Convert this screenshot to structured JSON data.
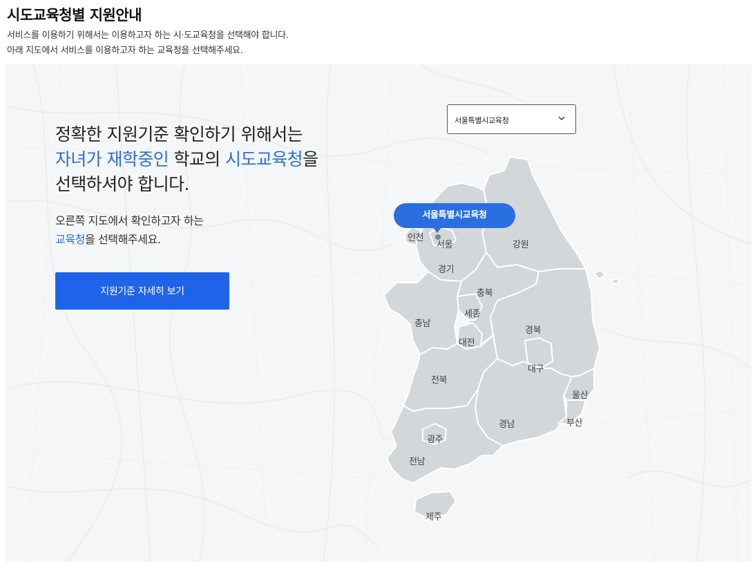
{
  "page": {
    "title": "시도교육청별 지원안내",
    "description_line1": "서비스를 이용하기 위해서는 이용하고자 하는 시·도교육청을 선택해야 합니다.",
    "description_line2": "아래 지도에서 서비스를 이용하고자 하는 교육청을 선택해주세요."
  },
  "hero": {
    "line1": "정확한 지원기준 확인하기 위해서는",
    "line2_highlight_a": "자녀가 재학중인",
    "line2_mid": " 학교의 ",
    "line2_highlight_b": "시도교육청",
    "line2_end": "을",
    "line3": "선택하셔야 합니다.",
    "sub_line1": "오른쪽 지도에서 확인하고자 하는",
    "sub_highlight": "교육청",
    "sub_line2_rest": "을 선택해주세요.",
    "cta_label": "지원기준 자세히 보기"
  },
  "select": {
    "selected": "서울특별시교육청",
    "icon": "chevron-down-icon"
  },
  "map": {
    "tooltip": "서울특별시교육청",
    "fill_color": "#d3d7da",
    "border_color": "#ffffff",
    "accent": "#2a6fe0",
    "regions": {
      "incheon": "인천",
      "seoul": "서울",
      "gangwon": "강원",
      "gyeonggi": "경기",
      "chungbuk": "충북",
      "chungnam": "충남",
      "sejong": "세종",
      "daejeon": "대전",
      "gyeongbuk": "경북",
      "daegu": "대구",
      "jeonbuk": "전북",
      "ulsan": "울산",
      "gyeongnam": "경남",
      "busan": "부산",
      "gwangju": "광주",
      "jeonnam": "전남",
      "jeju": "제주"
    }
  }
}
